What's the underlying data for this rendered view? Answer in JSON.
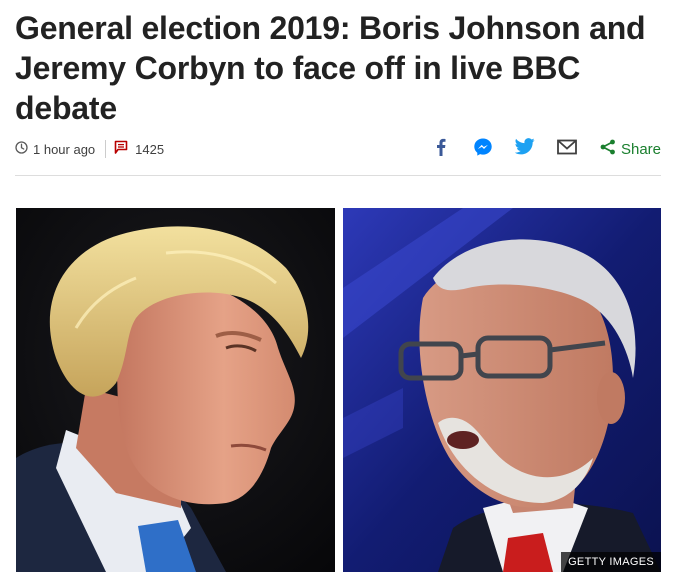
{
  "article": {
    "headline": "General election 2019: Boris Johnson and Jeremy Corbyn to face off in live BBC debate"
  },
  "meta": {
    "timestamp": "1 hour ago",
    "comments_count": "1425"
  },
  "share": {
    "share_label": "Share",
    "icons": [
      "facebook-icon",
      "messenger-icon",
      "twitter-icon",
      "email-icon",
      "share-icon"
    ]
  },
  "image": {
    "credit": "GETTY IMAGES"
  },
  "colors": {
    "facebook": "#3b5998",
    "messenger": "#0084ff",
    "twitter": "#1da1f2",
    "email": "#404040",
    "share": "#1a7f2e",
    "comments": "#b80000",
    "headline": "#222222"
  }
}
